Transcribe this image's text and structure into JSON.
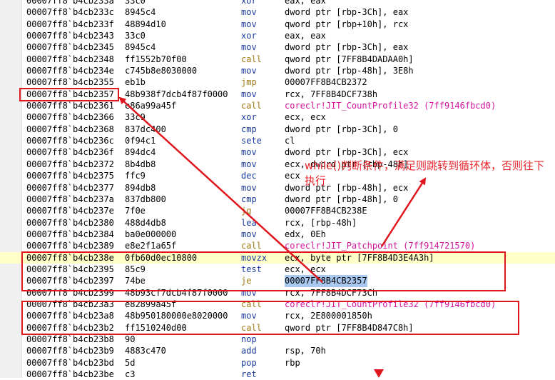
{
  "disassembly": {
    "rows": [
      {
        "addr": "00007ff8`b4cb233a",
        "hex": "33c0",
        "mnemonic": "xor",
        "operands": "eax, eax"
      },
      {
        "addr": "00007ff8`b4cb233c",
        "hex": "8945c4",
        "mnemonic": "mov",
        "operands": "dword ptr [rbp-3Ch], eax"
      },
      {
        "addr": "00007ff8`b4cb233f",
        "hex": "48894d10",
        "mnemonic": "mov",
        "operands": "qword ptr [rbp+10h], rcx"
      },
      {
        "addr": "00007ff8`b4cb2343",
        "hex": "33c0",
        "mnemonic": "xor",
        "operands": "eax, eax"
      },
      {
        "addr": "00007ff8`b4cb2345",
        "hex": "8945c4",
        "mnemonic": "mov",
        "operands": "dword ptr [rbp-3Ch], eax"
      },
      {
        "addr": "00007ff8`b4cb2348",
        "hex": "ff1552b70f00",
        "mnemonic": "call",
        "operands": "qword ptr [7FF8B4DADAA0h]"
      },
      {
        "addr": "00007ff8`b4cb234e",
        "hex": "c745b8e8030000",
        "mnemonic": "mov",
        "operands": "dword ptr [rbp-48h], 3E8h"
      },
      {
        "addr": "00007ff8`b4cb2355",
        "hex": "eb1b",
        "mnemonic": "jmp",
        "operands": "00007FF8B4CB2372"
      },
      {
        "addr": "00007ff8`b4cb2357",
        "hex": "48b938f7dcb4f87f0000",
        "mnemonic": "mov",
        "operands": "rcx, 7FF8B4DCF738h"
      },
      {
        "addr": "00007ff8`b4cb2361",
        "hex": "e86a99a45f",
        "mnemonic": "call",
        "operands": "coreclr!JIT_CountProfile32 (7ff9146fbcd0)"
      },
      {
        "addr": "00007ff8`b4cb2366",
        "hex": "33c9",
        "mnemonic": "xor",
        "operands": "ecx, ecx"
      },
      {
        "addr": "00007ff8`b4cb2368",
        "hex": "837dc400",
        "mnemonic": "cmp",
        "operands": "dword ptr [rbp-3Ch], 0"
      },
      {
        "addr": "00007ff8`b4cb236c",
        "hex": "0f94c1",
        "mnemonic": "sete",
        "operands": "cl"
      },
      {
        "addr": "00007ff8`b4cb236f",
        "hex": "894dc4",
        "mnemonic": "mov",
        "operands": "dword ptr [rbp-3Ch], ecx"
      },
      {
        "addr": "00007ff8`b4cb2372",
        "hex": "8b4db8",
        "mnemonic": "mov",
        "operands": "ecx, dword ptr [rbp-48h]"
      },
      {
        "addr": "00007ff8`b4cb2375",
        "hex": "ffc9",
        "mnemonic": "dec",
        "operands": "ecx"
      },
      {
        "addr": "00007ff8`b4cb2377",
        "hex": "894db8",
        "mnemonic": "mov",
        "operands": "dword ptr [rbp-48h], ecx"
      },
      {
        "addr": "00007ff8`b4cb237a",
        "hex": "837db800",
        "mnemonic": "cmp",
        "operands": "dword ptr [rbp-48h], 0"
      },
      {
        "addr": "00007ff8`b4cb237e",
        "hex": "7f0e",
        "mnemonic": "jg",
        "operands": "00007FF8B4CB238E"
      },
      {
        "addr": "00007ff8`b4cb2380",
        "hex": "488d4db8",
        "mnemonic": "lea",
        "operands": "rcx, [rbp-48h]"
      },
      {
        "addr": "00007ff8`b4cb2384",
        "hex": "ba0e000000",
        "mnemonic": "mov",
        "operands": "edx, 0Eh"
      },
      {
        "addr": "00007ff8`b4cb2389",
        "hex": "e8e2f1a65f",
        "mnemonic": "call",
        "operands": "coreclr!JIT_Patchpoint (7ff914721570)"
      },
      {
        "addr": "00007ff8`b4cb238e",
        "hex": "0fb60d0ec10800",
        "mnemonic": "movzx",
        "operands": "ecx, byte ptr [7FF8B4D3E4A3h]"
      },
      {
        "addr": "00007ff8`b4cb2395",
        "hex": "85c9",
        "mnemonic": "test",
        "operands": "ecx, ecx"
      },
      {
        "addr": "00007ff8`b4cb2397",
        "hex": "74be",
        "mnemonic": "je",
        "operands": "00007FF8B4CB2357"
      },
      {
        "addr": "00007ff8`b4cb2399",
        "hex": "48b93cf7dcb4f87f0000",
        "mnemonic": "mov",
        "operands": "rcx, 7FF8B4DCF73Ch"
      },
      {
        "addr": "00007ff8`b4cb23a3",
        "hex": "e82899a45f",
        "mnemonic": "call",
        "operands": "coreclr!JIT_CountProfile32 (7ff9146fbcd0)"
      },
      {
        "addr": "00007ff8`b4cb23a8",
        "hex": "48b950180000e8020000",
        "mnemonic": "mov",
        "operands": "rcx, 2E800001850h"
      },
      {
        "addr": "00007ff8`b4cb23b2",
        "hex": "ff1510240d00",
        "mnemonic": "call",
        "operands": "qword ptr [7FF8B4D847C8h]"
      },
      {
        "addr": "00007ff8`b4cb23b8",
        "hex": "90",
        "mnemonic": "nop",
        "operands": ""
      },
      {
        "addr": "00007ff8`b4cb23b9",
        "hex": "4883c470",
        "mnemonic": "add",
        "operands": "rsp, 70h"
      },
      {
        "addr": "00007ff8`b4cb23bd",
        "hex": "5d",
        "mnemonic": "pop",
        "operands": "rbp"
      },
      {
        "addr": "00007ff8`b4cb23be",
        "hex": "c3",
        "mnemonic": "ret",
        "operands": ""
      }
    ],
    "highlighted_row": 22,
    "selected_operand_row": 24
  },
  "annotation": {
    "text": "while()判断条件，满足则跳转到循环体，否则往下执行"
  },
  "colors": {
    "mnemonic": "#1b3b9c",
    "call_mnemonic": "#a07b16",
    "symbol": "#d3149c",
    "annotation": "#e8232b",
    "highlight_row": "#ffffc8",
    "selection": "#a8c8f0"
  }
}
